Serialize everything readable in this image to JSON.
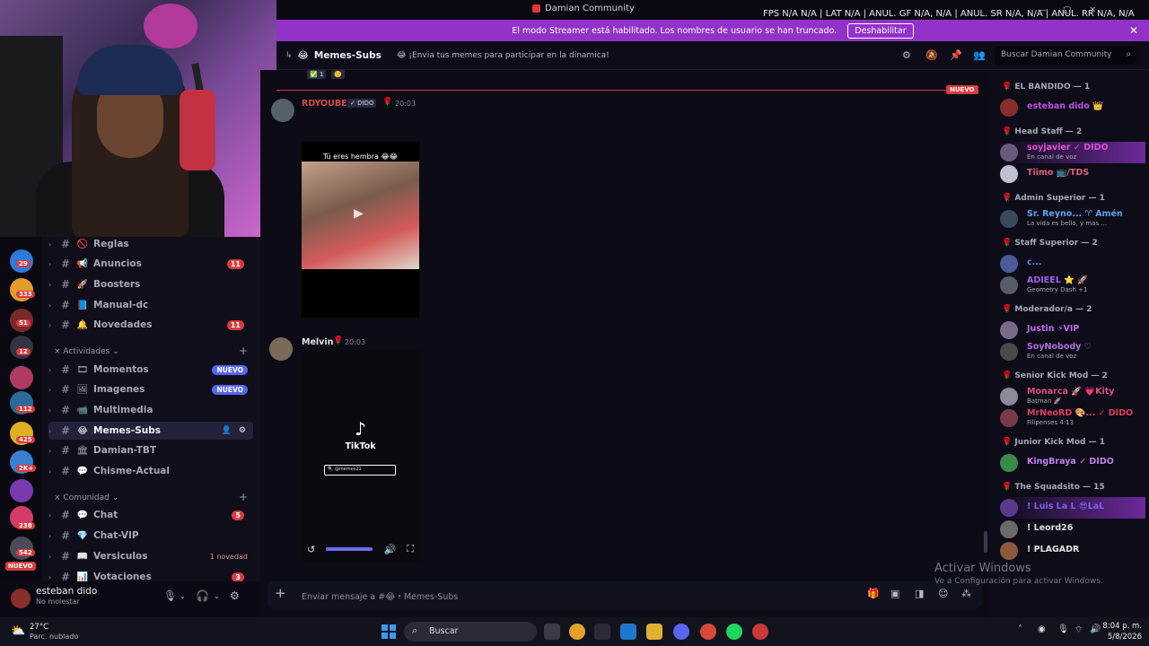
{
  "window": {
    "title": "Damian Community",
    "minimize": "—",
    "maximize": "▢",
    "close": "✕"
  },
  "overlay": {
    "fps_text": "FPS  N/A  N/A  |  LAT  N/A  |  ANUL. GF  N/A, N/A  |  ANUL. SR  N/A, N/A  |  ANUL. RR  N/A, N/A"
  },
  "banner": {
    "text": "El modo Streamer está habilitado. Los nombres de usuario se han truncado.",
    "button": "Deshabilitar",
    "close": "✕"
  },
  "rail": {
    "badges": [
      "29",
      "333",
      "51",
      "12",
      "112",
      "425",
      "2K+",
      "238",
      "542"
    ],
    "nuevo": "NUEVO",
    "colors": [
      "#2f7ad8",
      "#e39c2a",
      "#7a2a2a",
      "#333344",
      "#b03a66",
      "#2a6a9a",
      "#e0b020",
      "#3a80d0",
      "#7a3ab0",
      "#d63a6a",
      "#4a4a5a"
    ]
  },
  "channels": {
    "items": [
      {
        "emoji": "🚫",
        "name": "Reglas",
        "badge": "",
        "tag": ""
      },
      {
        "emoji": "📢",
        "name": "Anuncios",
        "badge": "11",
        "tag": ""
      },
      {
        "emoji": "🚀",
        "name": "Boosters",
        "badge": "",
        "tag": ""
      },
      {
        "emoji": "📘",
        "name": "Manual-dc",
        "badge": "",
        "tag": ""
      },
      {
        "emoji": "🔔",
        "name": "Novedades",
        "badge": "11",
        "tag": ""
      }
    ],
    "cat_actividades": "Actividades",
    "actividades": [
      {
        "emoji": "🎞",
        "name": "Momentos",
        "tag": "NUEVO"
      },
      {
        "emoji": "🖼",
        "name": "Imagenes",
        "tag": "NUEVO"
      },
      {
        "emoji": "📹",
        "name": "Multimedia",
        "tag": ""
      },
      {
        "emoji": "😂",
        "name": "Memes-Subs",
        "tag": ""
      },
      {
        "emoji": "🏛",
        "name": "Damian-TBT",
        "tag": ""
      },
      {
        "emoji": "💬",
        "name": "Chisme-Actual",
        "tag": ""
      }
    ],
    "cat_comunidad": "Comunidad",
    "comunidad": [
      {
        "emoji": "💬",
        "name": "Chat",
        "badge": "5",
        "note": ""
      },
      {
        "emoji": "💎",
        "name": "Chat-VIP",
        "badge": "",
        "note": ""
      },
      {
        "emoji": "📖",
        "name": "Versiculos",
        "badge": "",
        "note": "1 novedad"
      },
      {
        "emoji": "📊",
        "name": "Votaciones",
        "badge": "3",
        "note": ""
      }
    ]
  },
  "user": {
    "name": "esteban dido",
    "status": "No molestar"
  },
  "header": {
    "channel_emoji": "😂",
    "channel": "Memes-Subs",
    "topic": "😂 ¡Envia tus memes para participar en la dinamica!",
    "search_placeholder": "Buscar Damian Community"
  },
  "messages": [
    {
      "author": "RDYOUBE",
      "tag": "✓ DIDO",
      "time": "20:03",
      "caption": "Tú eres hembra 😂😂",
      "author_color": "#d84a4a"
    },
    {
      "author": "Melvin",
      "tag": "",
      "time": "20:03",
      "tiktok": "TikTok",
      "tiktok_search": "🔍 @memes21",
      "author_color": "#e4e4e8"
    }
  ],
  "reactions": [
    "✅ 1",
    "🙂"
  ],
  "nuevo": "NUEVO",
  "composer": {
    "placeholder": "Enviar mensaje a #😂・Memes-Subs"
  },
  "members": {
    "roles": [
      {
        "title": "EL BANDIDO — 1",
        "members": [
          {
            "name": "esteban dido 👑",
            "sub": "",
            "color": "#c050e0"
          }
        ]
      },
      {
        "title": "Head Staff — 2",
        "members": [
          {
            "name": "soyjavier ✓ DIDO",
            "sub": "En canal de voz",
            "color": "#e050d0"
          },
          {
            "name": "Tiimo  📺/TDS",
            "sub": "",
            "color": "#e06080"
          }
        ]
      },
      {
        "title": "Admin Superior — 1",
        "members": [
          {
            "name": "Sr. Reyno... ♈ Amén",
            "sub": "La vida es bella, y mas ...",
            "color": "#60a0f0"
          }
        ]
      },
      {
        "title": "Staff Superior — 2",
        "members": [
          {
            "name": "c...",
            "sub": "",
            "color": "#6080f0"
          },
          {
            "name": "ADIEEL ⭐ 🚀",
            "sub": "Geometry Dash +1",
            "color": "#a060f0"
          }
        ]
      },
      {
        "title": "Moderador/a — 2",
        "members": [
          {
            "name": "Justin ⚡VIP",
            "sub": "",
            "color": "#c070f0"
          },
          {
            "name": "SoyNobody ♡",
            "sub": "En canal de voz",
            "color": "#b070e0"
          }
        ]
      },
      {
        "title": "Senior Kick Mod — 2",
        "members": [
          {
            "name": "Monarca 🚀 💗Kity",
            "sub": "Batman 🚀",
            "color": "#e05080"
          },
          {
            "name": "MrNeoRD 🎨... ✓ DIDO",
            "sub": "Filipenses 4:13",
            "color": "#e04060"
          }
        ]
      },
      {
        "title": "Junior Kick Mod — 1",
        "members": [
          {
            "name": "KingBraya ✓ DIDO",
            "sub": "",
            "color": "#c080f0"
          }
        ]
      },
      {
        "title": "The Squadsito — 15",
        "members": [
          {
            "name": "! Luis La L 😎LaL",
            "sub": "",
            "color": "#8060f0"
          },
          {
            "name": "! Leord26",
            "sub": "",
            "color": "#e0e0e0"
          },
          {
            "name": "! PLAGADR",
            "sub": "",
            "color": "#e0e0e0"
          }
        ]
      }
    ]
  },
  "activate": {
    "title": "Activar Windows",
    "sub": "Ve a Configuración para activar Windows."
  },
  "taskbar": {
    "temp": "27°C",
    "weather": "Parc. nublado",
    "search": "Buscar",
    "time": "8:04 p. m.",
    "date": "5/8/2026"
  },
  "colors": {
    "accent": "#9232c8",
    "danger": "#d83c3e",
    "blurple": "#5865f2"
  }
}
